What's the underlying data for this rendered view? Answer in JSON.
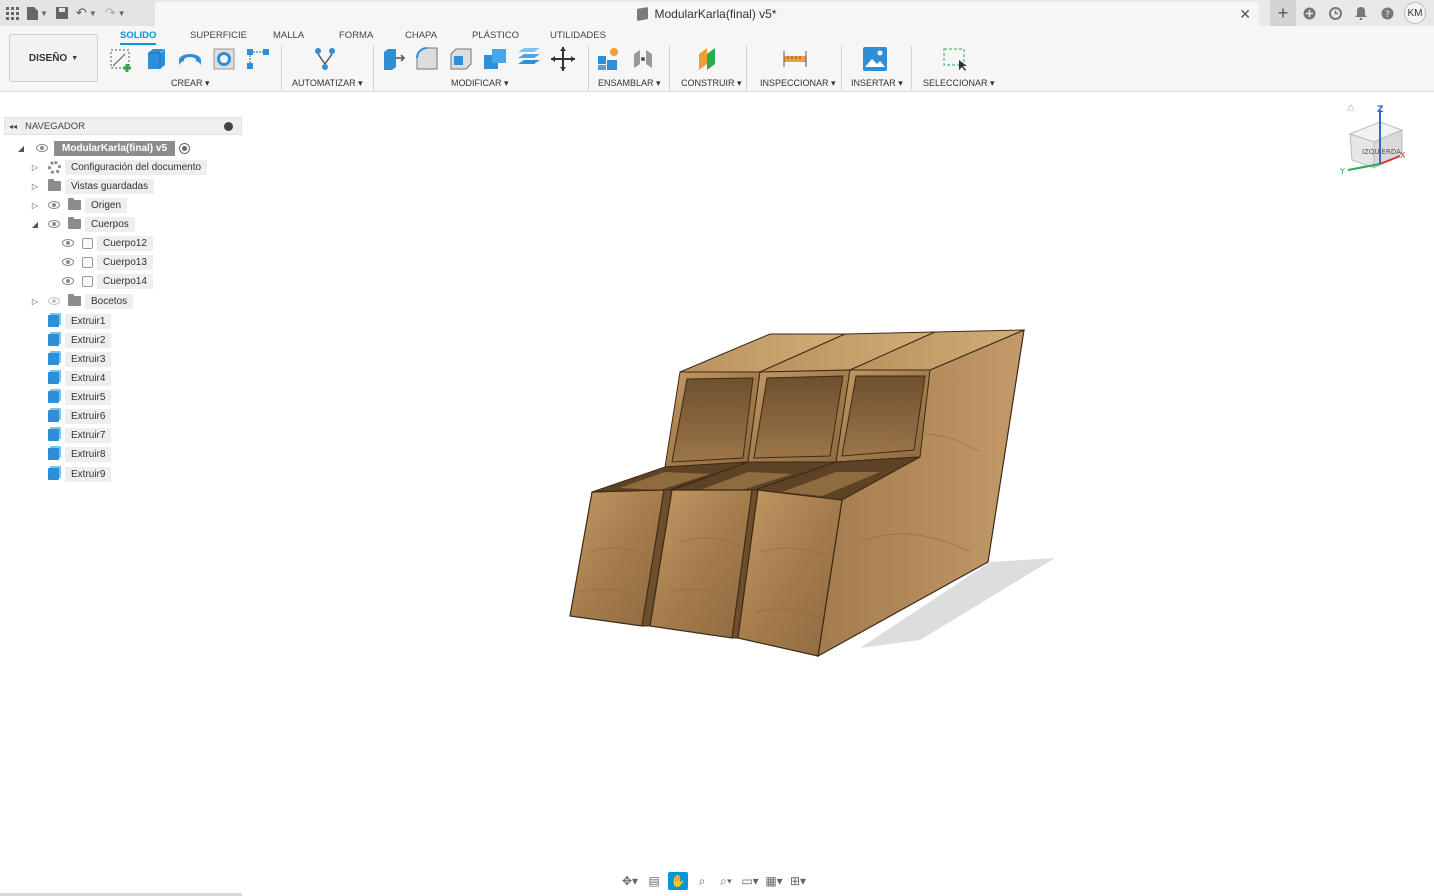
{
  "window": {
    "doc_title": "ModularKarla(final) v5*",
    "user_initials": "KM"
  },
  "toolbar": {
    "workspace": "DISEÑO",
    "tabs": [
      "SOLIDO",
      "SUPERFICIE",
      "MALLA",
      "FORMA",
      "CHAPA",
      "PLÁSTICO",
      "UTILIDADES"
    ],
    "active_tab": "SOLIDO",
    "groups": {
      "crear": "CREAR",
      "automatizar": "AUTOMATIZAR",
      "modificar": "MODIFICAR",
      "ensamblar": "ENSAMBLAR",
      "construir": "CONSTRUIR",
      "inspeccionar": "INSPECCIONAR",
      "insertar": "INSERTAR",
      "seleccionar": "SELECCIONAR"
    }
  },
  "browser": {
    "title": "NAVEGADOR",
    "root": "ModularKarla(final) v5",
    "items": {
      "config": "Configuración del documento",
      "vistas": "Vistas guardadas",
      "origen": "Origen",
      "cuerpos": "Cuerpos",
      "cuerpo12": "Cuerpo12",
      "cuerpo13": "Cuerpo13",
      "cuerpo14": "Cuerpo14",
      "bocetos": "Bocetos"
    },
    "features": [
      "Extruir1",
      "Extruir2",
      "Extruir3",
      "Extruir4",
      "Extruir5",
      "Extruir6",
      "Extruir7",
      "Extruir8",
      "Extruir9"
    ]
  },
  "viewcube": {
    "face": "IZQUIERDA",
    "axis_z": "Z",
    "axis_x": "X",
    "axis_y": "Y"
  },
  "colors": {
    "accent": "#0696d7",
    "wood_light": "#b58d5c",
    "wood_dark": "#7a5a35"
  }
}
